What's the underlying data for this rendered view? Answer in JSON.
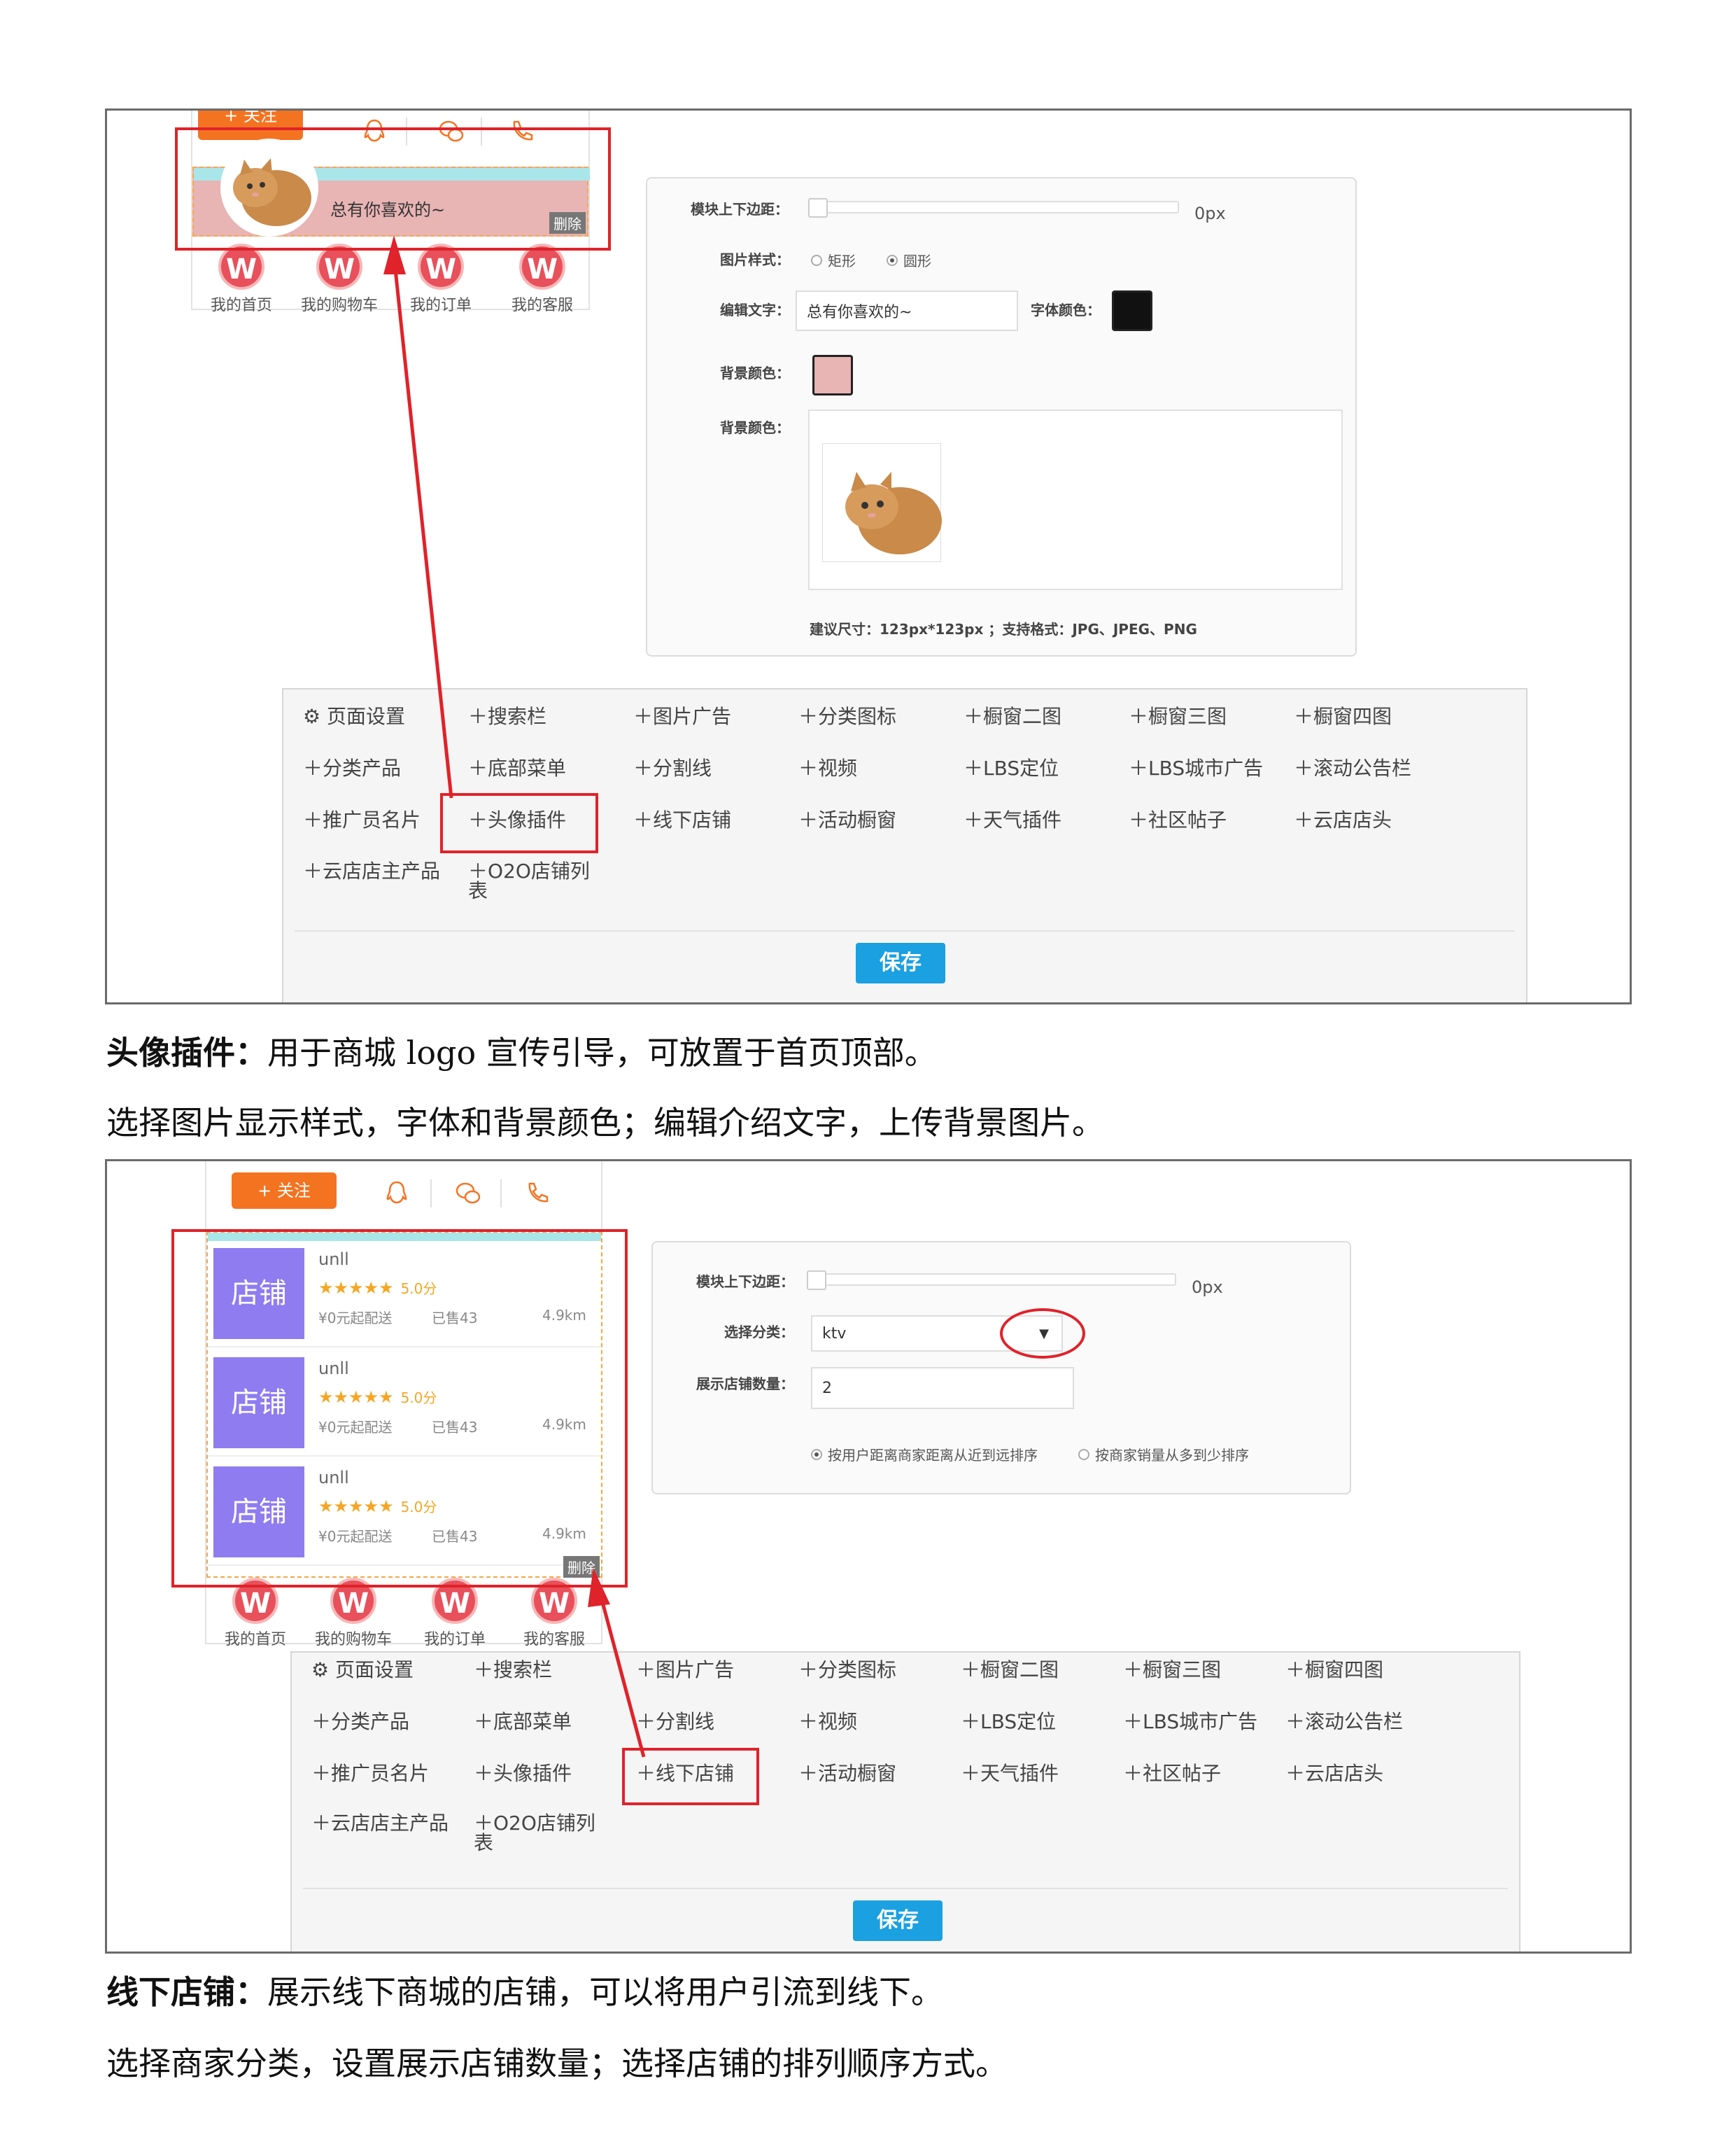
{
  "section1": {
    "phone": {
      "follow_label": "+ 关注",
      "banner_text": "总有你喜欢的~",
      "delete_label": "删除",
      "tabbar": [
        "我的首页",
        "我的购物车",
        "我的订单",
        "我的客服"
      ],
      "tab_icon_letter": "W"
    },
    "settings": {
      "margin_label": "模块上下边距：",
      "margin_value": "0px",
      "image_style_label": "图片样式：",
      "image_style_options": [
        "矩形",
        "圆形"
      ],
      "image_style_selected": "圆形",
      "edit_text_label": "编辑文字：",
      "edit_text_value": "总有你喜欢的~",
      "font_color_label": "字体颜色：",
      "font_color": "#111111",
      "bg_color_label": "背景颜色：",
      "bg_color": "#e8b4b4",
      "bg_image_label": "背景颜色：",
      "hint": "建议尺寸：123px*123px ；支持格式：JPG、JPEG、PNG"
    },
    "caption_title": "头像插件：",
    "caption_body": "用于商城 logo 宣传引导，可放置于首页顶部。",
    "caption_line2": "选择图片显示样式，字体和背景颜色；编辑介绍文字，上传背景图片。"
  },
  "menu": {
    "page_settings": "页面设置",
    "items": [
      "搜索栏",
      "图片广告",
      "分类图标",
      "橱窗二图",
      "橱窗三图",
      "橱窗四图",
      "分类产品",
      "底部菜单",
      "分割线",
      "视频",
      "LBS定位",
      "LBS城市广告",
      "滚动公告栏",
      "推广员名片",
      "头像插件",
      "线下店铺",
      "活动橱窗",
      "天气插件",
      "社区帖子",
      "云店店头",
      "云店店主产品",
      "O2O店铺列表"
    ],
    "save_label": "保存"
  },
  "section2": {
    "phone": {
      "follow_label": "+ 关注",
      "delete_label": "删除",
      "tabbar": [
        "我的首页",
        "我的购物车",
        "我的订单",
        "我的客服"
      ],
      "shops": [
        {
          "image_label": "店铺",
          "name": "unll",
          "stars": "★★★★★",
          "score": "5.0分",
          "delivery": "¥0元起配送",
          "sold": "已售43",
          "distance": "4.9km"
        },
        {
          "image_label": "店铺",
          "name": "unll",
          "stars": "★★★★★",
          "score": "5.0分",
          "delivery": "¥0元起配送",
          "sold": "已售43",
          "distance": "4.9km"
        },
        {
          "image_label": "店铺",
          "name": "unll",
          "stars": "★★★★★",
          "score": "5.0分",
          "delivery": "¥0元起配送",
          "sold": "已售43",
          "distance": "4.9km"
        }
      ]
    },
    "settings": {
      "margin_label": "模块上下边距：",
      "margin_value": "0px",
      "category_label": "选择分类：",
      "category_value": "ktv",
      "count_label": "展示店铺数量：",
      "count_value": "2",
      "sort_options": [
        "按用户距离商家距离从近到远排序",
        "按商家销量从多到少排序"
      ],
      "sort_selected": "按用户距离商家距离从近到远排序"
    },
    "caption_title": "线下店铺：",
    "caption_body": "展示线下商城的店铺，可以将用户引流到线下。",
    "caption_line2": "选择商家分类，设置展示店铺数量；选择店铺的排列顺序方式。"
  },
  "colors": {
    "accent_red": "#e0222a",
    "follow_orange": "#f47321",
    "save_blue": "#1ba0e1",
    "shop_purple": "#8e7cf0",
    "banner_cyan": "#a8e6ea"
  }
}
